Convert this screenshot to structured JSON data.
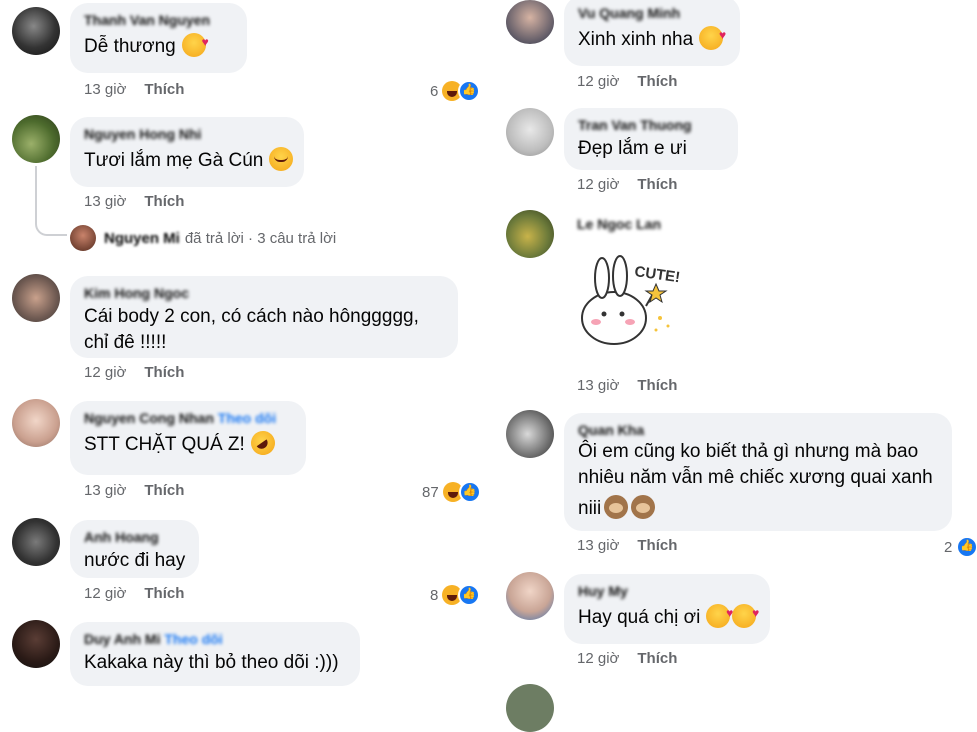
{
  "left_comments": [
    {
      "name": "Thanh Van Nguyen",
      "tag": "",
      "text": "Dễ thương",
      "emoji": "love",
      "time": "13 giờ",
      "like": "Thích",
      "reaction_count": "6"
    },
    {
      "name": "Nguyen Hong Nhi",
      "tag": "",
      "text": "Tươi lắm mẹ Gà Cún",
      "emoji": "sweat",
      "time": "13 giờ",
      "like": "Thích",
      "reaction_count": ""
    },
    {
      "name": "Kim Hong Ngoc",
      "tag": "",
      "text": "Cái body 2 con, có cách nào hônggggg,",
      "text2": "chỉ đê !!!!!",
      "emoji": "",
      "time": "12 giờ",
      "like": "Thích",
      "reaction_count": ""
    },
    {
      "name": "Nguyen Cong Nhan",
      "tag": "Theo dõi",
      "text": "STT CHẶT QUÁ Z!",
      "emoji": "rofl",
      "time": "13 giờ",
      "like": "Thích",
      "reaction_count": "87"
    },
    {
      "name": "Anh Hoang",
      "tag": "",
      "text": "nước đi hay",
      "emoji": "",
      "time": "12 giờ",
      "like": "Thích",
      "reaction_count": "8"
    },
    {
      "name": "Duy Anh Mi",
      "tag": "Theo dõi",
      "text": "Kakaka này thì bỏ theo dõi :)))",
      "emoji": "",
      "time": "",
      "like": "",
      "reaction_count": ""
    }
  ],
  "reply_summary": {
    "name": "Nguyen Mi",
    "text": "đã trả lời · 3 câu trả lời"
  },
  "right_comments": [
    {
      "name": "Vu Quang Minh",
      "text": "Xinh xinh nha",
      "emoji": "love",
      "time": "12 giờ",
      "like": "Thích",
      "reaction_count": ""
    },
    {
      "name": "Tran Van Thuong",
      "text": "Đẹp lắm e ưi",
      "emoji": "",
      "time": "12 giờ",
      "like": "Thích",
      "reaction_count": ""
    },
    {
      "name": "Le Ngoc Lan",
      "text": "",
      "emoji": "",
      "time": "13 giờ",
      "like": "Thích",
      "reaction_count": "",
      "sticker_text": "CUTE!"
    },
    {
      "name": "Quan Kha",
      "text": "Ôi em cũng ko biết thả gì nhưng mà bao",
      "text2": "nhiêu năm vẫn mê chiếc xương quai xanh",
      "text3": "niii",
      "emoji": "monkey",
      "time": "13 giờ",
      "like": "Thích",
      "reaction_count": "2"
    },
    {
      "name": "Huy My",
      "text": "Hay quá chị ơi",
      "emoji": "love",
      "time": "12 giờ",
      "like": "Thích",
      "reaction_count": ""
    }
  ],
  "icons": {
    "haha": "haha-reaction-icon",
    "like": "like-reaction-icon",
    "love_face": "smiling-face-with-hearts-icon"
  },
  "colors": {
    "bubble": "#f0f2f5",
    "meta": "#65676b",
    "link": "#1877f2"
  }
}
